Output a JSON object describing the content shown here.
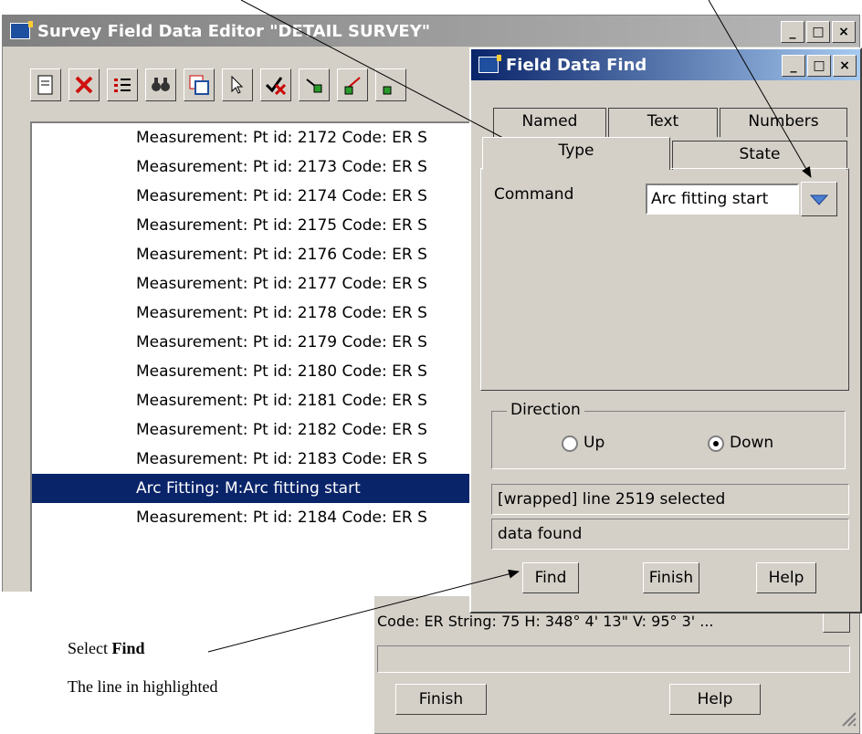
{
  "main_window": {
    "title": "Survey Field Data Editor \"DETAIL SURVEY\"",
    "list_rows": [
      "Measurement:  Pt id: 2172 Code: ER S",
      "Measurement:  Pt id: 2173 Code: ER S",
      "Measurement:  Pt id: 2174 Code: ER S",
      "Measurement:  Pt id: 2175 Code: ER S",
      "Measurement:  Pt id: 2176 Code: ER S",
      "Measurement:  Pt id: 2177 Code: ER S",
      "Measurement:  Pt id: 2178 Code: ER S",
      "Measurement:  Pt id: 2179 Code: ER S",
      "Measurement:  Pt id: 2180 Code: ER S",
      "Measurement:  Pt id: 2181 Code: ER S",
      "Measurement:  Pt id: 2182 Code: ER S",
      "Measurement:  Pt id: 2183 Code: ER S",
      "Arc Fitting:  M:Arc fitting start",
      "Measurement:  Pt id: 2184 Code: ER S"
    ],
    "selected_row_index": 12,
    "partial_row": "Code: ER String: 75 H:  348°  4' 13\" V:   95°  3' ...",
    "finish_label": "Finish",
    "help_label": "Help"
  },
  "dialog": {
    "title": "Field Data Find",
    "tabs_back": [
      "Named",
      "Text",
      "Numbers"
    ],
    "tabs_front": [
      "Type",
      "State"
    ],
    "command_label": "Command",
    "command_value": "Arc fitting start",
    "direction_label": "Direction",
    "radio_up": "Up",
    "radio_down": "Down",
    "direction_selected": "Down",
    "status_line1": "[wrapped]  line 2519 selected",
    "status_line2": "data found",
    "find_label": "Find",
    "finish_label": "Finish",
    "help_label": "Help"
  },
  "annotation": {
    "select_prefix": "Select ",
    "select_bold": "Find",
    "line2": "The line in highlighted"
  },
  "colors": {
    "selection": "#0a246a",
    "dialog_title": "#0a246a",
    "dropdown_arrow": "#4a7fd0"
  }
}
